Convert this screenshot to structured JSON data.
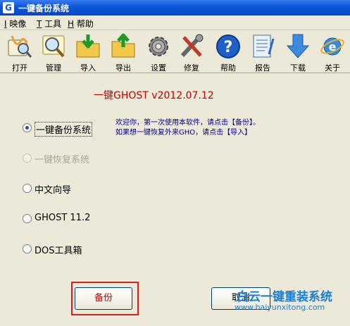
{
  "window": {
    "title": "一键备份系统"
  },
  "menu": [
    {
      "key": "I",
      "label": "映像"
    },
    {
      "key": "T",
      "label": "工具"
    },
    {
      "key": "H",
      "label": "帮助"
    }
  ],
  "toolbar": [
    {
      "label": "打开",
      "icon": "open-icon"
    },
    {
      "label": "管理",
      "icon": "manage-icon"
    },
    {
      "label": "导入",
      "icon": "import-icon"
    },
    {
      "label": "导出",
      "icon": "export-icon"
    },
    {
      "label": "设置",
      "icon": "settings-icon"
    },
    {
      "label": "修复",
      "icon": "repair-icon"
    },
    {
      "label": "帮助",
      "icon": "help-icon"
    },
    {
      "label": "报告",
      "icon": "report-icon"
    },
    {
      "label": "下载",
      "icon": "download-icon"
    },
    {
      "label": "关于",
      "icon": "about-icon"
    }
  ],
  "version": "一键GHOST v2012.07.12",
  "welcome": {
    "line1": "欢迎你，第一次使用本软件，请点击【备份】。",
    "line2": "如果想一键恢复外来GHO，请点击【导入】"
  },
  "options": [
    {
      "label": "一键备份系统",
      "checked": true,
      "disabled": false
    },
    {
      "label": "一键恢复系统",
      "checked": false,
      "disabled": true
    },
    {
      "label": "中文向导",
      "checked": false,
      "disabled": false
    },
    {
      "label": "GHOST 11.2",
      "checked": false,
      "disabled": false
    },
    {
      "label": "DOS工具箱",
      "checked": false,
      "disabled": false
    }
  ],
  "buttons": {
    "backup": "备份",
    "cancel": "取消"
  },
  "watermark": {
    "line1": "白云一键重装系统",
    "line2": "www.baiyunxitong.com"
  }
}
